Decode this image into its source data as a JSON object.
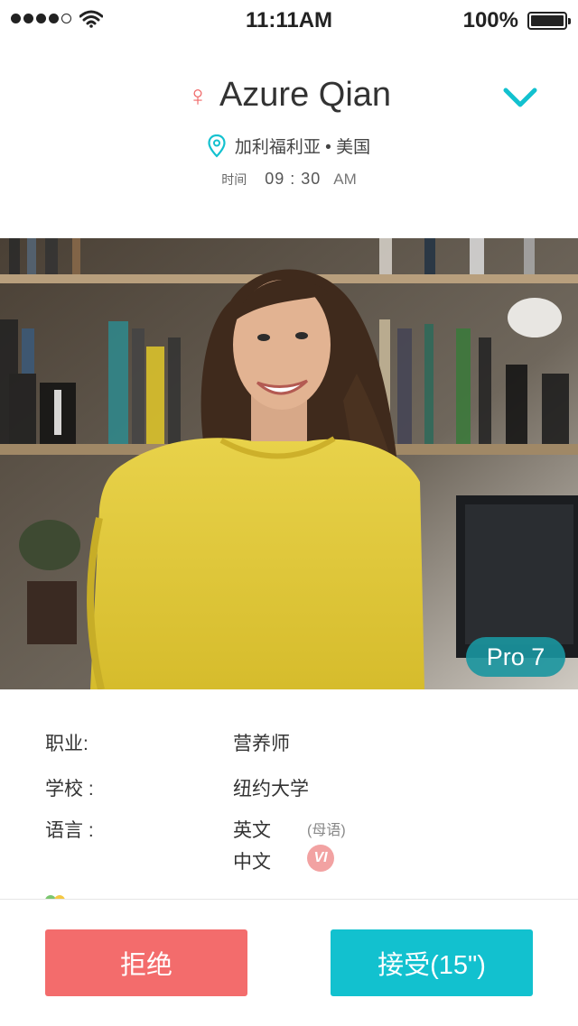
{
  "status_bar": {
    "time": "11:11AM",
    "battery": "100%"
  },
  "profile": {
    "name": "Azure Qian",
    "location": "加利福利亚 • 美国",
    "time_label": "时间",
    "time_value": "09 : 30",
    "time_ampm": "AM",
    "badge": "Pro 7"
  },
  "details": {
    "job_label": "职业:",
    "job_value": "营养师",
    "school_label": "学校 :",
    "school_value": "纽约大学",
    "language_label": "语言 :",
    "languages": [
      {
        "name": "英文",
        "note": "(母语)"
      },
      {
        "name": "中文",
        "badge": "VI"
      }
    ]
  },
  "actions": {
    "reject": "拒绝",
    "accept": "接受(15\")"
  },
  "colors": {
    "accent": "#12c1cf",
    "reject": "#f36c6c",
    "female": "#f06a6a"
  }
}
